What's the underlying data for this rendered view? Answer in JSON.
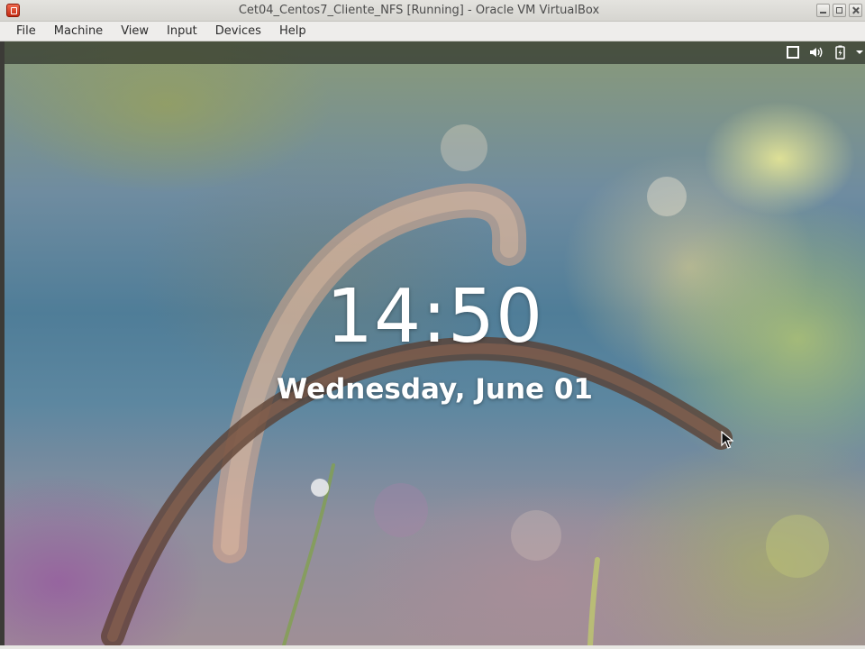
{
  "window": {
    "title": "Cet04_Centos7_Cliente_NFS [Running] - Oracle VM VirtualBox"
  },
  "menu": {
    "items": [
      "File",
      "Machine",
      "View",
      "Input",
      "Devices",
      "Help"
    ]
  },
  "lockscreen": {
    "time": "14:50",
    "date": "Wednesday, June 01"
  },
  "panel": {
    "icons": [
      "screen-icon",
      "volume-icon",
      "battery-icon",
      "dropdown-arrow-icon"
    ]
  },
  "colors": {
    "titlebar": "#dcdbd6",
    "menubar": "#eeedeb",
    "clock_text": "#ffffff"
  }
}
